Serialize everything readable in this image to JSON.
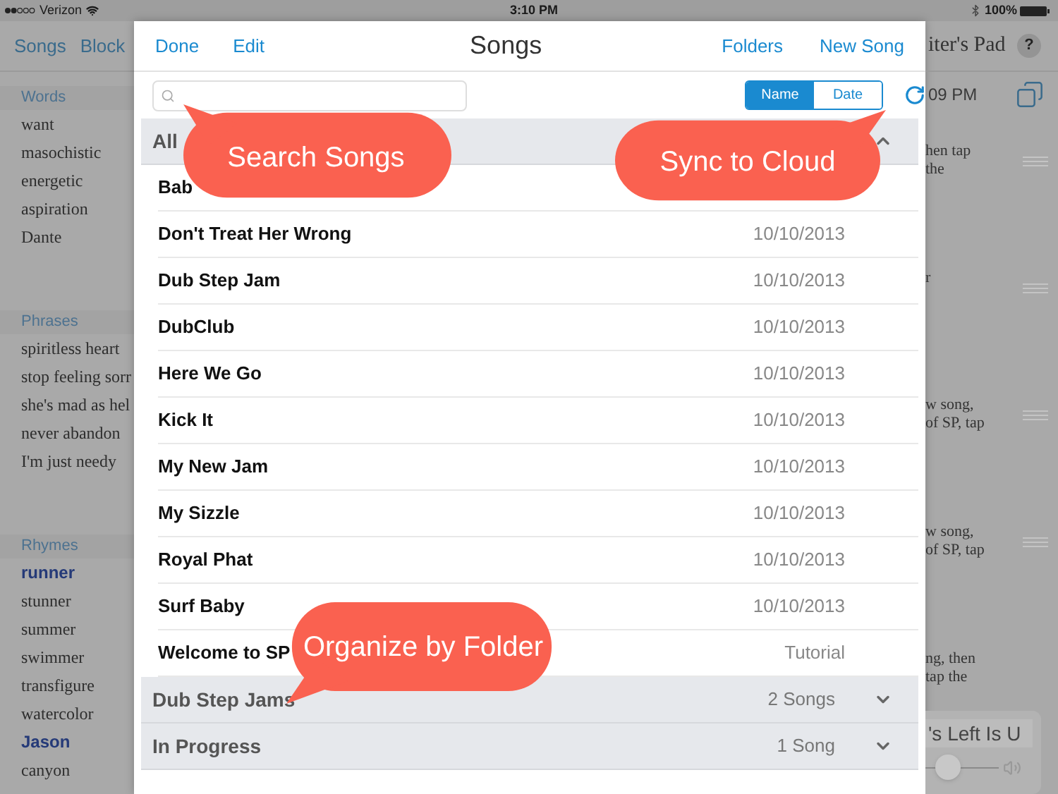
{
  "status_bar": {
    "carrier": "Verizon",
    "time": "3:10 PM",
    "battery": "100%"
  },
  "background_app": {
    "tabs": [
      "Songs",
      "Block"
    ],
    "sections": [
      {
        "title": "Words",
        "items": [
          {
            "text": "want",
            "highlighted": false
          },
          {
            "text": "masochistic",
            "highlighted": false
          },
          {
            "text": "energetic",
            "highlighted": false
          },
          {
            "text": "aspiration",
            "highlighted": false
          },
          {
            "text": "Dante",
            "highlighted": false
          }
        ]
      },
      {
        "title": "Phrases",
        "items": [
          {
            "text": "spiritless heart",
            "highlighted": false
          },
          {
            "text": "stop feeling sorr",
            "highlighted": false
          },
          {
            "text": "she's mad as hel",
            "highlighted": false
          },
          {
            "text": "never abandon",
            "highlighted": false
          },
          {
            "text": "I'm just needy",
            "highlighted": false
          }
        ]
      },
      {
        "title": "Rhymes",
        "items": [
          {
            "text": "runner",
            "highlighted": true
          },
          {
            "text": "stunner",
            "highlighted": false
          },
          {
            "text": "summer",
            "highlighted": false
          },
          {
            "text": "swimmer",
            "highlighted": false
          },
          {
            "text": "transfigure",
            "highlighted": false
          },
          {
            "text": "watercolor",
            "highlighted": false
          },
          {
            "text": "Jason",
            "highlighted": true
          },
          {
            "text": "canyon",
            "highlighted": false
          }
        ]
      }
    ],
    "title": "iter's Pad",
    "help": "?",
    "time_fragment": "09 PM",
    "notes": [
      {
        "lines": [
          "hen tap",
          "the"
        ],
        "handle": true
      },
      {
        "lines": [
          "r"
        ],
        "handle": true
      },
      {
        "lines": [
          "w song,",
          "of SP, tap"
        ],
        "handle": true
      },
      {
        "lines": [
          "w song,",
          "of SP, tap"
        ],
        "handle": true
      },
      {
        "lines": [
          "ng, then",
          "tap the"
        ],
        "handle": false
      }
    ],
    "player": {
      "field_value": "'s Left Is U",
      "level": 0.2
    }
  },
  "songs_panel": {
    "nav_left": [
      "Done",
      "Edit"
    ],
    "title": "Songs",
    "nav_right": [
      "Folders",
      "New Song"
    ],
    "sort": [
      {
        "label": "Name",
        "selected": true
      },
      {
        "label": "Date",
        "selected": false
      }
    ],
    "groups": [
      {
        "name": "All",
        "expanded": true,
        "songs": [
          {
            "title": "Bab"
          },
          {
            "title": "Don't Treat Her Wrong",
            "date": "10/10/2013"
          },
          {
            "title": "Dub Step Jam",
            "date": "10/10/2013"
          },
          {
            "title": "DubClub",
            "date": "10/10/2013"
          },
          {
            "title": "Here We Go",
            "date": "10/10/2013"
          },
          {
            "title": "Kick It",
            "date": "10/10/2013"
          },
          {
            "title": "My New Jam",
            "date": "10/10/2013"
          },
          {
            "title": "My Sizzle",
            "date": "10/10/2013"
          },
          {
            "title": "Royal Phat",
            "date": "10/10/2013"
          },
          {
            "title": "Surf Baby",
            "date": "10/10/2013"
          },
          {
            "title": "Welcome to SP",
            "date": "Tutorial"
          }
        ]
      },
      {
        "name": "Dub Step Jams",
        "count": "2 Songs",
        "expanded": false
      },
      {
        "name": "In Progress",
        "count": "1 Song",
        "expanded": false
      }
    ]
  },
  "callouts": [
    {
      "text": "Search Songs",
      "kind": "upleft"
    },
    {
      "text": "Sync to Cloud",
      "kind": "upright"
    },
    {
      "text": "Organize by Folder",
      "kind": "downleft"
    }
  ]
}
